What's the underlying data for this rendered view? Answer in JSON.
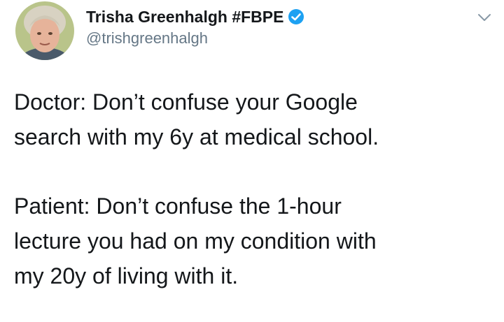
{
  "author": {
    "display_name": "Trisha Greenhalgh #FBPE",
    "handle": "@trishgreenhalgh",
    "verified": true,
    "verified_color": "#1da1f2",
    "avatar_icon": "profile-photo"
  },
  "menu": {
    "icon": "chevron-down-icon"
  },
  "tweet": {
    "line1": "Doctor: Don’t confuse your Google",
    "line2": "search with my 6y at medical school.",
    "line3": "Patient: Don’t confuse the 1-hour",
    "line4": "lecture you had on my condition with",
    "line5": "my 20y of living with it."
  }
}
